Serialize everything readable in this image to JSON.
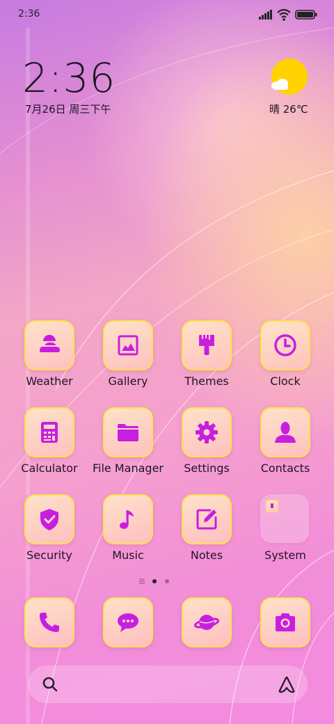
{
  "status_bar": {
    "time": "2:36",
    "icons": [
      "signal-icon",
      "wifi-icon",
      "battery-icon"
    ]
  },
  "clock_widget": {
    "time": "2:36",
    "date": "7月26日 周三下午"
  },
  "weather_widget": {
    "icon": "sun-cloud-icon",
    "text": "晴 26℃"
  },
  "colors": {
    "accent": "#c81ee0",
    "tile_border": "#ffe24a",
    "sun": "#ffd200"
  },
  "apps": [
    {
      "label": "Weather",
      "icon": "weather-icon"
    },
    {
      "label": "Gallery",
      "icon": "gallery-icon"
    },
    {
      "label": "Themes",
      "icon": "themes-brush-icon"
    },
    {
      "label": "Clock",
      "icon": "clock-icon"
    },
    {
      "label": "Calculator",
      "icon": "calculator-icon"
    },
    {
      "label": "File Manager",
      "icon": "folder-icon"
    },
    {
      "label": "Settings",
      "icon": "gear-icon"
    },
    {
      "label": "Contacts",
      "icon": "person-icon"
    },
    {
      "label": "Security",
      "icon": "shield-check-icon"
    },
    {
      "label": "Music",
      "icon": "music-note-icon"
    },
    {
      "label": "Notes",
      "icon": "notes-pencil-icon"
    },
    {
      "label": "System",
      "icon": "folder-group-icon"
    }
  ],
  "page_indicator": {
    "pages": 2,
    "current": 1
  },
  "dock": [
    {
      "icon": "phone-icon"
    },
    {
      "icon": "message-icon"
    },
    {
      "icon": "browser-planet-icon"
    },
    {
      "icon": "camera-icon"
    }
  ],
  "search_bar": {
    "icons": [
      "search-icon",
      "assistant-icon"
    ]
  }
}
